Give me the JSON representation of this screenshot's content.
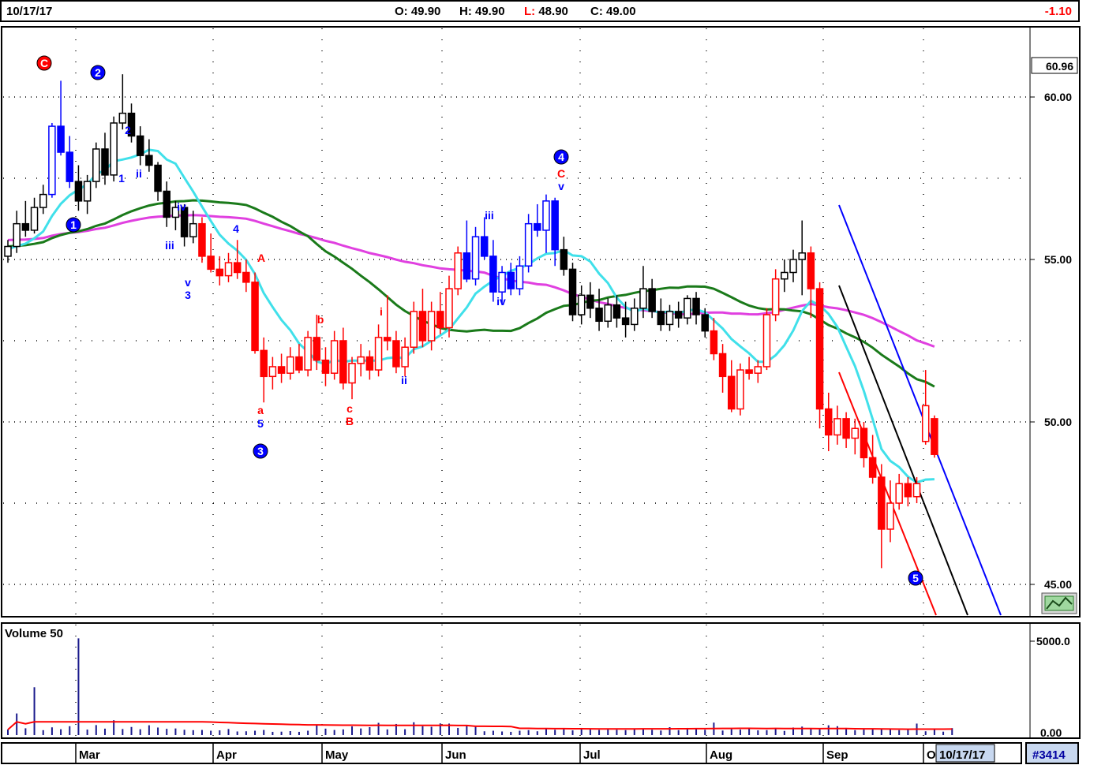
{
  "header": {
    "date": "10/17/17",
    "open_label": "O:",
    "open": "49.90",
    "high_label": "H:",
    "high": "49.90",
    "low_label": "L:",
    "low": "48.90",
    "close_label": "C:",
    "close": "49.00",
    "change": "-1.10"
  },
  "price_axis": {
    "current_label": "60.96",
    "ticks": [
      "60.00",
      "55.00",
      "50.00",
      "45.00"
    ],
    "tick_values": [
      60,
      55,
      50,
      45
    ]
  },
  "volume_panel": {
    "label": "Volume 50",
    "ticks": [
      "5000.0",
      "0.00"
    ]
  },
  "time_axis": {
    "months": [
      "Mar",
      "Apr",
      "May",
      "Jun",
      "Jul",
      "Aug",
      "Sep",
      "O"
    ],
    "cursor_date": "10/17/17",
    "chart_id": "#3414"
  },
  "colors": {
    "up_candle": "#ffffff",
    "down_candle": "#000000",
    "wave_red": "#ff0000",
    "wave_blue": "#0000ff",
    "ma_short": "#40e0ea",
    "ma_mid": "#1a7a1a",
    "ma_long": "#e040e0",
    "volume_bar": "#1a1a8c",
    "volume_ma": "#ff0000"
  },
  "chart_data": {
    "type": "candlestick",
    "title": "",
    "ylim": [
      44,
      62
    ],
    "ohlc": [
      [
        55.1,
        55.6,
        54.9,
        55.4
      ],
      [
        55.4,
        56.5,
        55.2,
        56.1
      ],
      [
        56.1,
        56.8,
        55.7,
        55.9
      ],
      [
        55.9,
        56.9,
        55.8,
        56.6
      ],
      [
        56.6,
        57.3,
        56.4,
        57.0
      ],
      [
        57.0,
        59.2,
        56.9,
        59.1
      ],
      [
        59.1,
        60.5,
        58.2,
        58.3
      ],
      [
        58.3,
        58.8,
        57.2,
        57.4
      ],
      [
        57.4,
        57.9,
        56.5,
        56.8
      ],
      [
        56.8,
        57.6,
        56.4,
        57.4
      ],
      [
        57.4,
        58.6,
        57.2,
        58.4
      ],
      [
        58.4,
        58.9,
        57.3,
        57.6
      ],
      [
        57.6,
        59.4,
        57.4,
        59.2
      ],
      [
        59.2,
        60.7,
        59.0,
        59.5
      ],
      [
        59.5,
        59.8,
        58.6,
        58.8
      ],
      [
        58.8,
        59.1,
        57.9,
        58.2
      ],
      [
        58.2,
        58.7,
        57.7,
        57.9
      ],
      [
        57.9,
        58.0,
        56.8,
        57.1
      ],
      [
        57.1,
        57.4,
        56.0,
        56.3
      ],
      [
        56.3,
        56.8,
        55.9,
        56.6
      ],
      [
        56.6,
        56.7,
        55.4,
        55.7
      ],
      [
        55.7,
        56.5,
        55.5,
        56.1
      ],
      [
        56.1,
        56.3,
        54.9,
        55.1
      ],
      [
        55.1,
        55.8,
        54.6,
        54.7
      ],
      [
        54.7,
        55.1,
        54.2,
        54.5
      ],
      [
        54.5,
        55.2,
        54.3,
        54.9
      ],
      [
        54.9,
        55.6,
        54.4,
        54.6
      ],
      [
        54.6,
        55.0,
        54.0,
        54.3
      ],
      [
        54.3,
        54.6,
        52.1,
        52.2
      ],
      [
        52.2,
        52.6,
        50.6,
        51.4
      ],
      [
        51.4,
        52.0,
        51.0,
        51.7
      ],
      [
        51.7,
        52.1,
        51.2,
        51.5
      ],
      [
        51.5,
        52.3,
        51.3,
        52.0
      ],
      [
        52.0,
        52.4,
        51.5,
        51.6
      ],
      [
        51.6,
        52.8,
        51.4,
        52.6
      ],
      [
        52.6,
        53.3,
        51.6,
        51.9
      ],
      [
        51.9,
        52.3,
        51.1,
        51.5
      ],
      [
        51.5,
        52.8,
        51.3,
        52.5
      ],
      [
        52.5,
        52.9,
        51.0,
        51.2
      ],
      [
        51.2,
        52.0,
        50.7,
        51.8
      ],
      [
        51.8,
        52.4,
        51.4,
        52.0
      ],
      [
        52.0,
        52.2,
        51.3,
        51.6
      ],
      [
        51.6,
        53.0,
        51.4,
        52.6
      ],
      [
        52.6,
        53.9,
        52.2,
        52.5
      ],
      [
        52.5,
        52.8,
        51.5,
        51.7
      ],
      [
        51.7,
        52.6,
        51.4,
        52.3
      ],
      [
        52.3,
        53.7,
        52.1,
        53.4
      ],
      [
        53.4,
        54.1,
        52.3,
        52.5
      ],
      [
        52.5,
        53.7,
        52.2,
        53.4
      ],
      [
        53.4,
        54.0,
        52.7,
        52.9
      ],
      [
        52.9,
        54.5,
        52.6,
        54.1
      ],
      [
        54.1,
        55.4,
        53.9,
        55.2
      ],
      [
        55.2,
        56.2,
        54.3,
        54.4
      ],
      [
        54.4,
        56.0,
        54.2,
        55.7
      ],
      [
        55.7,
        56.3,
        55.0,
        55.1
      ],
      [
        55.1,
        55.6,
        53.7,
        54.0
      ],
      [
        54.0,
        54.8,
        53.6,
        54.6
      ],
      [
        54.6,
        54.9,
        53.9,
        54.1
      ],
      [
        54.1,
        55.1,
        53.9,
        54.8
      ],
      [
        54.8,
        56.4,
        54.6,
        56.1
      ],
      [
        56.1,
        56.7,
        55.7,
        55.9
      ],
      [
        55.9,
        57.0,
        55.2,
        56.8
      ],
      [
        56.8,
        56.9,
        54.8,
        55.3
      ],
      [
        55.3,
        55.7,
        54.5,
        54.7
      ],
      [
        54.7,
        54.9,
        53.1,
        53.3
      ],
      [
        53.3,
        54.2,
        53.0,
        53.9
      ],
      [
        53.9,
        54.3,
        53.2,
        53.5
      ],
      [
        53.5,
        54.1,
        52.8,
        53.1
      ],
      [
        53.1,
        53.8,
        52.9,
        53.6
      ],
      [
        53.6,
        53.9,
        52.9,
        53.2
      ],
      [
        53.2,
        53.7,
        52.6,
        53.0
      ],
      [
        53.0,
        53.8,
        52.8,
        53.5
      ],
      [
        53.5,
        54.8,
        53.2,
        54.1
      ],
      [
        54.1,
        54.4,
        53.2,
        53.4
      ],
      [
        53.4,
        53.8,
        52.8,
        53.0
      ],
      [
        53.0,
        53.6,
        52.8,
        53.4
      ],
      [
        53.4,
        53.7,
        52.9,
        53.2
      ],
      [
        53.2,
        53.9,
        53.0,
        53.8
      ],
      [
        53.8,
        54.0,
        53.0,
        53.3
      ],
      [
        53.3,
        53.5,
        52.6,
        52.8
      ],
      [
        52.8,
        53.2,
        51.9,
        52.1
      ],
      [
        52.1,
        52.4,
        50.9,
        51.4
      ],
      [
        51.4,
        51.9,
        50.3,
        50.4
      ],
      [
        50.4,
        51.8,
        50.2,
        51.6
      ],
      [
        51.6,
        52.0,
        51.3,
        51.5
      ],
      [
        51.5,
        51.9,
        51.2,
        51.7
      ],
      [
        51.7,
        53.5,
        51.6,
        53.3
      ],
      [
        53.3,
        54.7,
        53.1,
        54.4
      ],
      [
        54.4,
        55.0,
        54.0,
        54.6
      ],
      [
        54.6,
        55.3,
        54.3,
        55.0
      ],
      [
        55.0,
        56.2,
        53.9,
        55.2
      ],
      [
        55.2,
        55.4,
        53.2,
        54.1
      ],
      [
        54.1,
        54.3,
        49.8,
        50.4
      ],
      [
        50.4,
        50.9,
        49.1,
        49.6
      ],
      [
        49.6,
        50.5,
        49.3,
        50.1
      ],
      [
        50.1,
        50.3,
        49.2,
        49.5
      ],
      [
        49.5,
        50.1,
        49.0,
        49.8
      ],
      [
        49.8,
        50.0,
        48.6,
        48.9
      ],
      [
        48.9,
        49.6,
        48.1,
        48.3
      ],
      [
        48.3,
        48.7,
        45.5,
        46.7
      ],
      [
        46.7,
        48.2,
        46.3,
        47.5
      ],
      [
        47.5,
        48.4,
        47.3,
        48.1
      ],
      [
        48.1,
        48.3,
        47.4,
        47.7
      ],
      [
        47.7,
        48.3,
        47.5,
        48.1
      ],
      [
        49.4,
        51.6,
        49.3,
        50.5
      ],
      [
        50.1,
        50.2,
        48.9,
        49.0
      ]
    ],
    "volume": [
      290,
      1150,
      360,
      2550,
      260,
      410,
      310,
      470,
      5150,
      290,
      530,
      340,
      790,
      320,
      430,
      310,
      520,
      400,
      330,
      350,
      280,
      260,
      270,
      230,
      250,
      320,
      190,
      200,
      230,
      270,
      170,
      180,
      210,
      170,
      230,
      550,
      340,
      270,
      300,
      460,
      350,
      420,
      650,
      300,
      590,
      310,
      680,
      470,
      440,
      620,
      610,
      380,
      520,
      480,
      200,
      230,
      190,
      170,
      230,
      260,
      200,
      320,
      280,
      310,
      250,
      380,
      290,
      270,
      330,
      280,
      260,
      350,
      310,
      280,
      240,
      420,
      260,
      380,
      350,
      280,
      660,
      240,
      310,
      290,
      340,
      250,
      260,
      330,
      220,
      400,
      450,
      330,
      300,
      520,
      470,
      380,
      260,
      290,
      300,
      330,
      340,
      260,
      280,
      610,
      200,
      350,
      180,
      370
    ],
    "volume_ylim": [
      0,
      5500
    ],
    "annotations": [
      {
        "label": "C",
        "color": "red",
        "circled": true
      },
      {
        "label": "1",
        "color": "blue",
        "circled": true
      },
      {
        "label": "2",
        "color": "blue",
        "circled": true
      },
      {
        "label": "2",
        "color": "blue",
        "circled": false
      },
      {
        "label": "1",
        "color": "blue",
        "circled": false
      },
      {
        "label": "ii",
        "color": "blue",
        "circled": false
      },
      {
        "label": "iii",
        "color": "blue",
        "circled": false
      },
      {
        "label": "iv",
        "color": "blue",
        "circled": false
      },
      {
        "label": "v",
        "color": "blue",
        "circled": false
      },
      {
        "label": "3",
        "color": "blue",
        "circled": false
      },
      {
        "label": "4",
        "color": "blue",
        "circled": false
      },
      {
        "label": "A",
        "color": "red",
        "circled": false
      },
      {
        "label": "a",
        "color": "red",
        "circled": false
      },
      {
        "label": "5",
        "color": "blue",
        "circled": false
      },
      {
        "label": "3",
        "color": "blue",
        "circled": true
      },
      {
        "label": "b",
        "color": "red",
        "circled": false
      },
      {
        "label": "c",
        "color": "red",
        "circled": false
      },
      {
        "label": "B",
        "color": "red",
        "circled": false
      },
      {
        "label": "i",
        "color": "red",
        "circled": false
      },
      {
        "label": "ii",
        "color": "blue",
        "circled": false
      },
      {
        "label": "iii",
        "color": "blue",
        "circled": false
      },
      {
        "label": "iv",
        "color": "blue",
        "circled": false
      },
      {
        "label": "4",
        "color": "blue",
        "circled": true
      },
      {
        "label": "C",
        "color": "red",
        "circled": false
      },
      {
        "label": "v",
        "color": "blue",
        "circled": false
      },
      {
        "label": "5",
        "color": "blue",
        "circled": true
      }
    ]
  }
}
